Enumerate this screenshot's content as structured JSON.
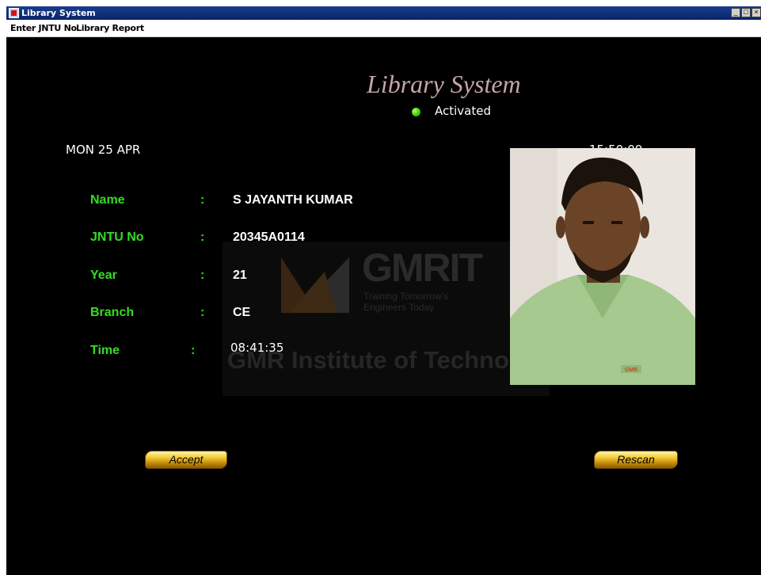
{
  "window": {
    "title": "Library System",
    "controls": [
      "_",
      "□",
      "×"
    ]
  },
  "menu": [
    {
      "label": "Enter JNTU No"
    },
    {
      "label": "Library Report"
    }
  ],
  "header": {
    "title": "Library System",
    "status": "Activated",
    "status_color": "#33cc00"
  },
  "date": "MON 25 APR",
  "clock": "15:50:09",
  "fields": {
    "name": {
      "label": "Name",
      "value": "S JAYANTH KUMAR"
    },
    "jntu": {
      "label": "JNTU No",
      "value": "20345A0114"
    },
    "year": {
      "label": "Year",
      "value": "21"
    },
    "branch": {
      "label": "Branch",
      "value": "CE"
    },
    "time": {
      "label": "Time",
      "value": "08:41:35"
    }
  },
  "separator": ":",
  "watermark": {
    "brand": "GMRIT",
    "tagline": "Training Tomorrow's Engineers Today",
    "institute": "GMR Institute of Technology"
  },
  "photo": {
    "shirt_badge": "GMR"
  },
  "buttons": {
    "accept": "Accept",
    "rescan": "Rescan"
  },
  "colors": {
    "label_green": "#33dd22",
    "title_color": "#c7a5a5",
    "button_gold": "#f4cf3a"
  }
}
